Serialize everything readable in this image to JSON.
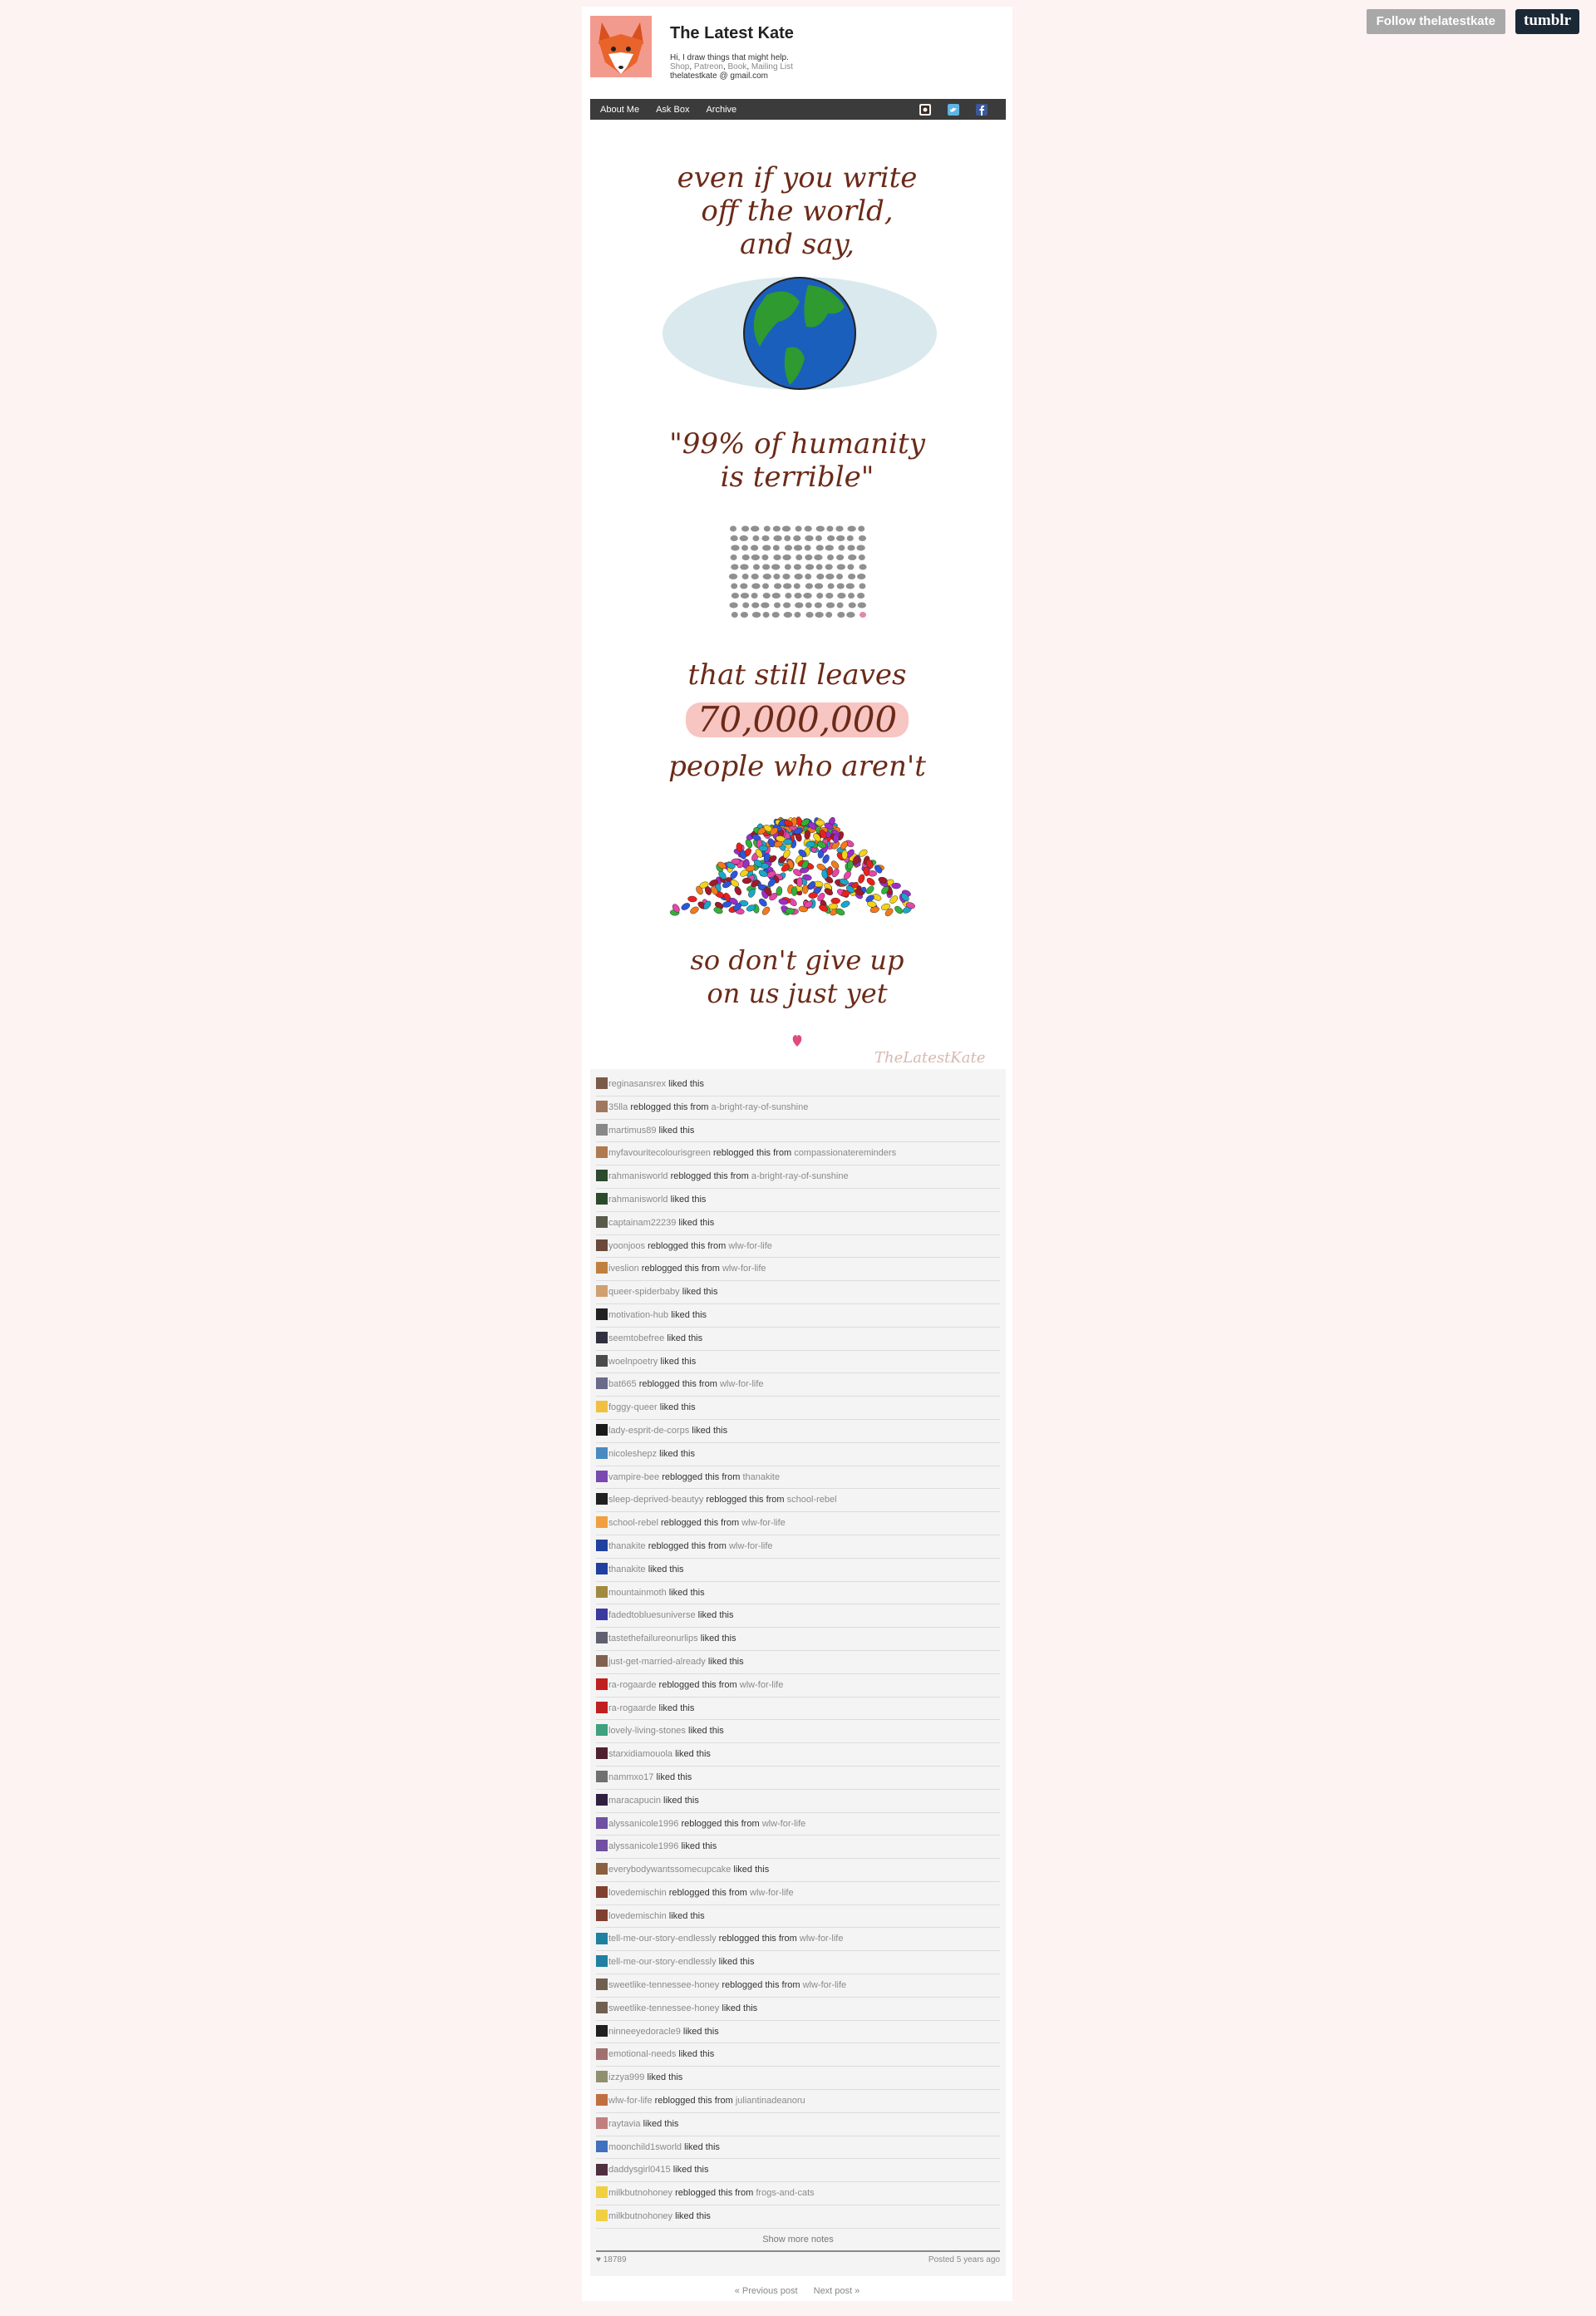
{
  "controls": {
    "follow_label": "Follow thelatestkate",
    "logo": "tumblr"
  },
  "blog": {
    "title": "The Latest Kate",
    "description": "Hi, I draw things that might help.",
    "links": [
      "Shop",
      "Patreon",
      "Book",
      "Mailing List"
    ],
    "email": "thelatestkate @ gmail.com"
  },
  "nav": {
    "items": [
      "About Me",
      "Ask Box",
      "Archive"
    ],
    "icons": [
      "instagram-icon",
      "twitter-icon",
      "facebook-icon"
    ]
  },
  "artwork": {
    "lines": [
      "even if you write",
      "off the world,",
      "and say,",
      "\"99% of humanity",
      "is terrible\"",
      "that still leaves",
      "70,000,000",
      "people who aren't",
      "so don't give up",
      "on us just yet"
    ],
    "signature": "TheLatestKate"
  },
  "notes": [
    {
      "user": "reginasansrex",
      "action": "liked this",
      "color": "#7a5a48"
    },
    {
      "user": "35lla",
      "action": "reblogged this from",
      "source": "a-bright-ray-of-sunshine",
      "color": "#a07860"
    },
    {
      "user": "martimus89",
      "action": "liked this",
      "color": "#888888"
    },
    {
      "user": "myfavouritecolourisgreen",
      "action": "reblogged this from",
      "source": "compassionatereminders",
      "color": "#b07a50"
    },
    {
      "user": "rahmanisworld",
      "action": "reblogged this from",
      "source": "a-bright-ray-of-sunshine",
      "color": "#2d4a2d"
    },
    {
      "user": "rahmanisworld",
      "action": "liked this",
      "color": "#2d4a2d"
    },
    {
      "user": "captainam22239",
      "action": "liked this",
      "color": "#5a5a4a"
    },
    {
      "user": "yoonjoos",
      "action": "reblogged this from",
      "source": "wlw-for-life",
      "color": "#6a4a3a"
    },
    {
      "user": "iveslion",
      "action": "reblogged this from",
      "source": "wlw-for-life",
      "color": "#c08040"
    },
    {
      "user": "queer-spiderbaby",
      "action": "liked this",
      "color": "#d0a070"
    },
    {
      "user": "motivation-hub",
      "action": "liked this",
      "color": "#222222"
    },
    {
      "user": "seemtobefree",
      "action": "liked this",
      "color": "#303040"
    },
    {
      "user": "woelnpoetry",
      "action": "liked this",
      "color": "#4a4a4a"
    },
    {
      "user": "bat665",
      "action": "reblogged this from",
      "source": "wlw-for-life",
      "color": "#6a6a8a"
    },
    {
      "user": "foggy-queer",
      "action": "liked this",
      "color": "#f0c040"
    },
    {
      "user": "lady-esprit-de-corps",
      "action": "liked this",
      "color": "#1a1a1a"
    },
    {
      "user": "nicoleshepz",
      "action": "liked this",
      "color": "#4a8ac0"
    },
    {
      "user": "vampire-bee",
      "action": "reblogged this from",
      "source": "thanakite",
      "color": "#7a4ab0"
    },
    {
      "user": "sleep-deprived-beautyy",
      "action": "reblogged this from",
      "source": "school-rebel",
      "color": "#202020"
    },
    {
      "user": "school-rebel",
      "action": "reblogged this from",
      "source": "wlw-for-life",
      "color": "#f0a040"
    },
    {
      "user": "thanakite",
      "action": "reblogged this from",
      "source": "wlw-for-life",
      "color": "#2040a0"
    },
    {
      "user": "thanakite",
      "action": "liked this",
      "color": "#2040a0"
    },
    {
      "user": "mountainmoth",
      "action": "liked this",
      "color": "#a08a40"
    },
    {
      "user": "fadedtobluesuniverse",
      "action": "liked this",
      "color": "#3a3aa0"
    },
    {
      "user": "tastethefailureonurlips",
      "action": "liked this",
      "color": "#606070"
    },
    {
      "user": "just-get-married-already",
      "action": "liked this",
      "color": "#806050"
    },
    {
      "user": "ra-rogaarde",
      "action": "reblogged this from",
      "source": "wlw-for-life",
      "color": "#c02020"
    },
    {
      "user": "ra-rogaarde",
      "action": "liked this",
      "color": "#c02020"
    },
    {
      "user": "lovely-living-stones",
      "action": "liked this",
      "color": "#40a080"
    },
    {
      "user": "starxidiamouola",
      "action": "liked this",
      "color": "#502030"
    },
    {
      "user": "nammxo17",
      "action": "liked this",
      "color": "#707070"
    },
    {
      "user": "maracapucin",
      "action": "liked this",
      "color": "#302040"
    },
    {
      "user": "alyssanicole1996",
      "action": "reblogged this from",
      "source": "wlw-for-life",
      "color": "#7050a0"
    },
    {
      "user": "alyssanicole1996",
      "action": "liked this",
      "color": "#7050a0"
    },
    {
      "user": "everybodywantssomecupcake",
      "action": "liked this",
      "color": "#8a6040"
    },
    {
      "user": "lovedemischin",
      "action": "reblogged this from",
      "source": "wlw-for-life",
      "color": "#804030"
    },
    {
      "user": "lovedemischin",
      "action": "liked this",
      "color": "#804030"
    },
    {
      "user": "tell-me-our-story-endlessly",
      "action": "reblogged this from",
      "source": "wlw-for-life",
      "color": "#2080a0"
    },
    {
      "user": "tell-me-our-story-endlessly",
      "action": "liked this",
      "color": "#2080a0"
    },
    {
      "user": "sweetlike-tennessee-honey",
      "action": "reblogged this from",
      "source": "wlw-for-life",
      "color": "#706050"
    },
    {
      "user": "sweetlike-tennessee-honey",
      "action": "liked this",
      "color": "#706050"
    },
    {
      "user": "ninneeyedoracle9",
      "action": "liked this",
      "color": "#202020"
    },
    {
      "user": "emotional-needs",
      "action": "liked this",
      "color": "#a07070"
    },
    {
      "user": "izzya999",
      "action": "liked this",
      "color": "#909070"
    },
    {
      "user": "wlw-for-life",
      "action": "reblogged this from",
      "source": "juliantinadeanoru",
      "color": "#c07040"
    },
    {
      "user": "raytavia",
      "action": "liked this",
      "color": "#c08080"
    },
    {
      "user": "moonchild1sworld",
      "action": "liked this",
      "color": "#4070c0"
    },
    {
      "user": "daddysgirl0415",
      "action": "liked this",
      "color": "#503040"
    },
    {
      "user": "milkbutnohoney",
      "action": "reblogged this from",
      "source": "frogs-and-cats",
      "color": "#f0d040"
    },
    {
      "user": "milkbutnohoney",
      "action": "liked this",
      "color": "#f0d040"
    }
  ],
  "show_more": "Show more notes",
  "footer": {
    "count": "♥ 18789",
    "posted": "Posted 5 years ago"
  },
  "pagination": {
    "prev": "« Previous post",
    "next": "Next post »"
  }
}
